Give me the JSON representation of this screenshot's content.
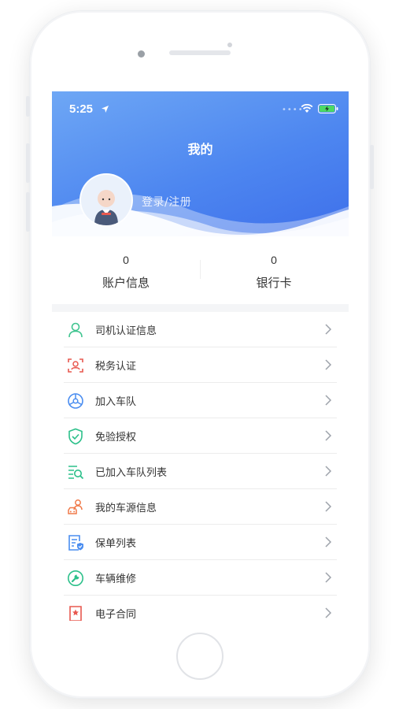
{
  "status_bar": {
    "time": "5:25"
  },
  "header": {
    "title": "我的",
    "login_text": "登录/注册"
  },
  "stats": [
    {
      "value": "0",
      "label": "账户信息"
    },
    {
      "value": "0",
      "label": "银行卡"
    }
  ],
  "menu": [
    {
      "label": "司机认证信息",
      "icon": "user-outline-icon",
      "color": "#3fc48f"
    },
    {
      "label": "税务认证",
      "icon": "face-scan-icon",
      "color": "#e8584f"
    },
    {
      "label": "加入车队",
      "icon": "steering-wheel-icon",
      "color": "#4a8df0"
    },
    {
      "label": "免验授权",
      "icon": "shield-check-icon",
      "color": "#2cc08a"
    },
    {
      "label": "已加入车队列表",
      "icon": "list-search-icon",
      "color": "#2cc08a"
    },
    {
      "label": "我的车源信息",
      "icon": "person-car-icon",
      "color": "#f07a4a"
    },
    {
      "label": "保单列表",
      "icon": "policy-document-icon",
      "color": "#4a8df0"
    },
    {
      "label": "车辆维修",
      "icon": "wrench-icon",
      "color": "#2cc08a"
    },
    {
      "label": "电子合同",
      "icon": "contract-icon",
      "color": "#e8584f"
    }
  ],
  "colors": {
    "header_top": "#6ea7f5",
    "header_bottom": "#3d6eea",
    "chevron": "#9ea3ab"
  }
}
